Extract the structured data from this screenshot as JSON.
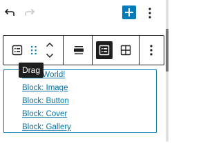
{
  "header": {
    "undo_icon": "undo-icon",
    "redo_icon": "redo-icon",
    "inserter_icon": "plus-icon",
    "more_icon": "vertical-dots-icon",
    "accent": "#007cba"
  },
  "block_toolbar": {
    "block_type_icon": "list-icon",
    "drag_icon": "drag-handle-icon",
    "move_up_icon": "chevron-up-icon",
    "move_down_icon": "chevron-down-icon",
    "align_icon": "align-wide-icon",
    "list_view_icon": "list-view-icon",
    "grid_view_icon": "grid-view-icon",
    "options_icon": "vertical-dots-icon"
  },
  "tooltip": {
    "text": "Drag"
  },
  "list": {
    "items": [
      {
        "label": "Hello World!"
      },
      {
        "label": "Block: Image"
      },
      {
        "label": "Block: Button"
      },
      {
        "label": "Block: Cover"
      },
      {
        "label": "Block: Gallery"
      }
    ],
    "link_color": "#0073aa",
    "selected_border": "#007cba"
  }
}
